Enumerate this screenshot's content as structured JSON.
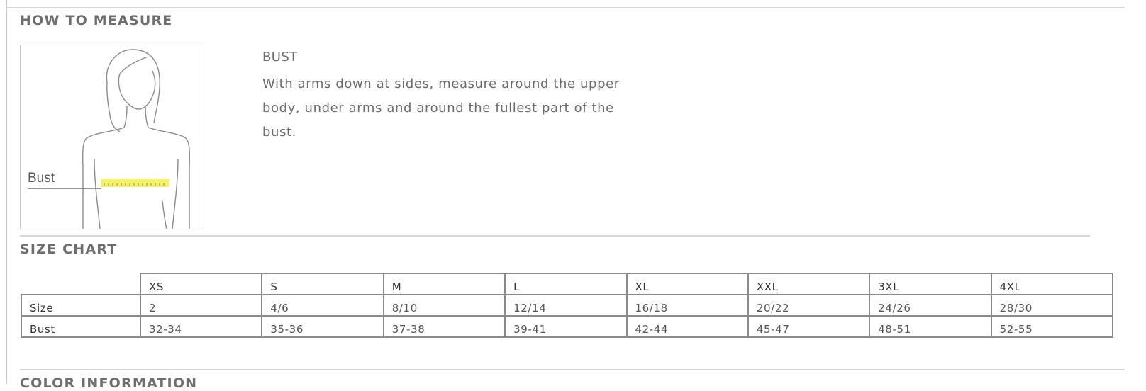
{
  "how_to_measure": {
    "title": "HOW TO MEASURE",
    "figure_label": "Bust",
    "bust_title": "BUST",
    "bust_description": "With arms down at sides, measure around the upper body, under arms and around the fullest part of the bust."
  },
  "size_chart": {
    "title": "SIZE CHART",
    "columns": [
      "XS",
      "S",
      "M",
      "L",
      "XL",
      "XXL",
      "3XL",
      "4XL"
    ],
    "rows": [
      {
        "label": "Size",
        "values": [
          "2",
          "4/6",
          "8/10",
          "12/14",
          "16/18",
          "20/22",
          "24/26",
          "28/30"
        ]
      },
      {
        "label": "Bust",
        "values": [
          "32-34",
          "35-36",
          "37-38",
          "39-41",
          "42-44",
          "45-47",
          "48-51",
          "52-55"
        ]
      }
    ]
  },
  "color_information": {
    "title": "COLOR INFORMATION"
  },
  "colors": {
    "rule": "#d6d6d6",
    "tape_highlight": "#f5f06a",
    "table_border": "#8a8a8a"
  }
}
